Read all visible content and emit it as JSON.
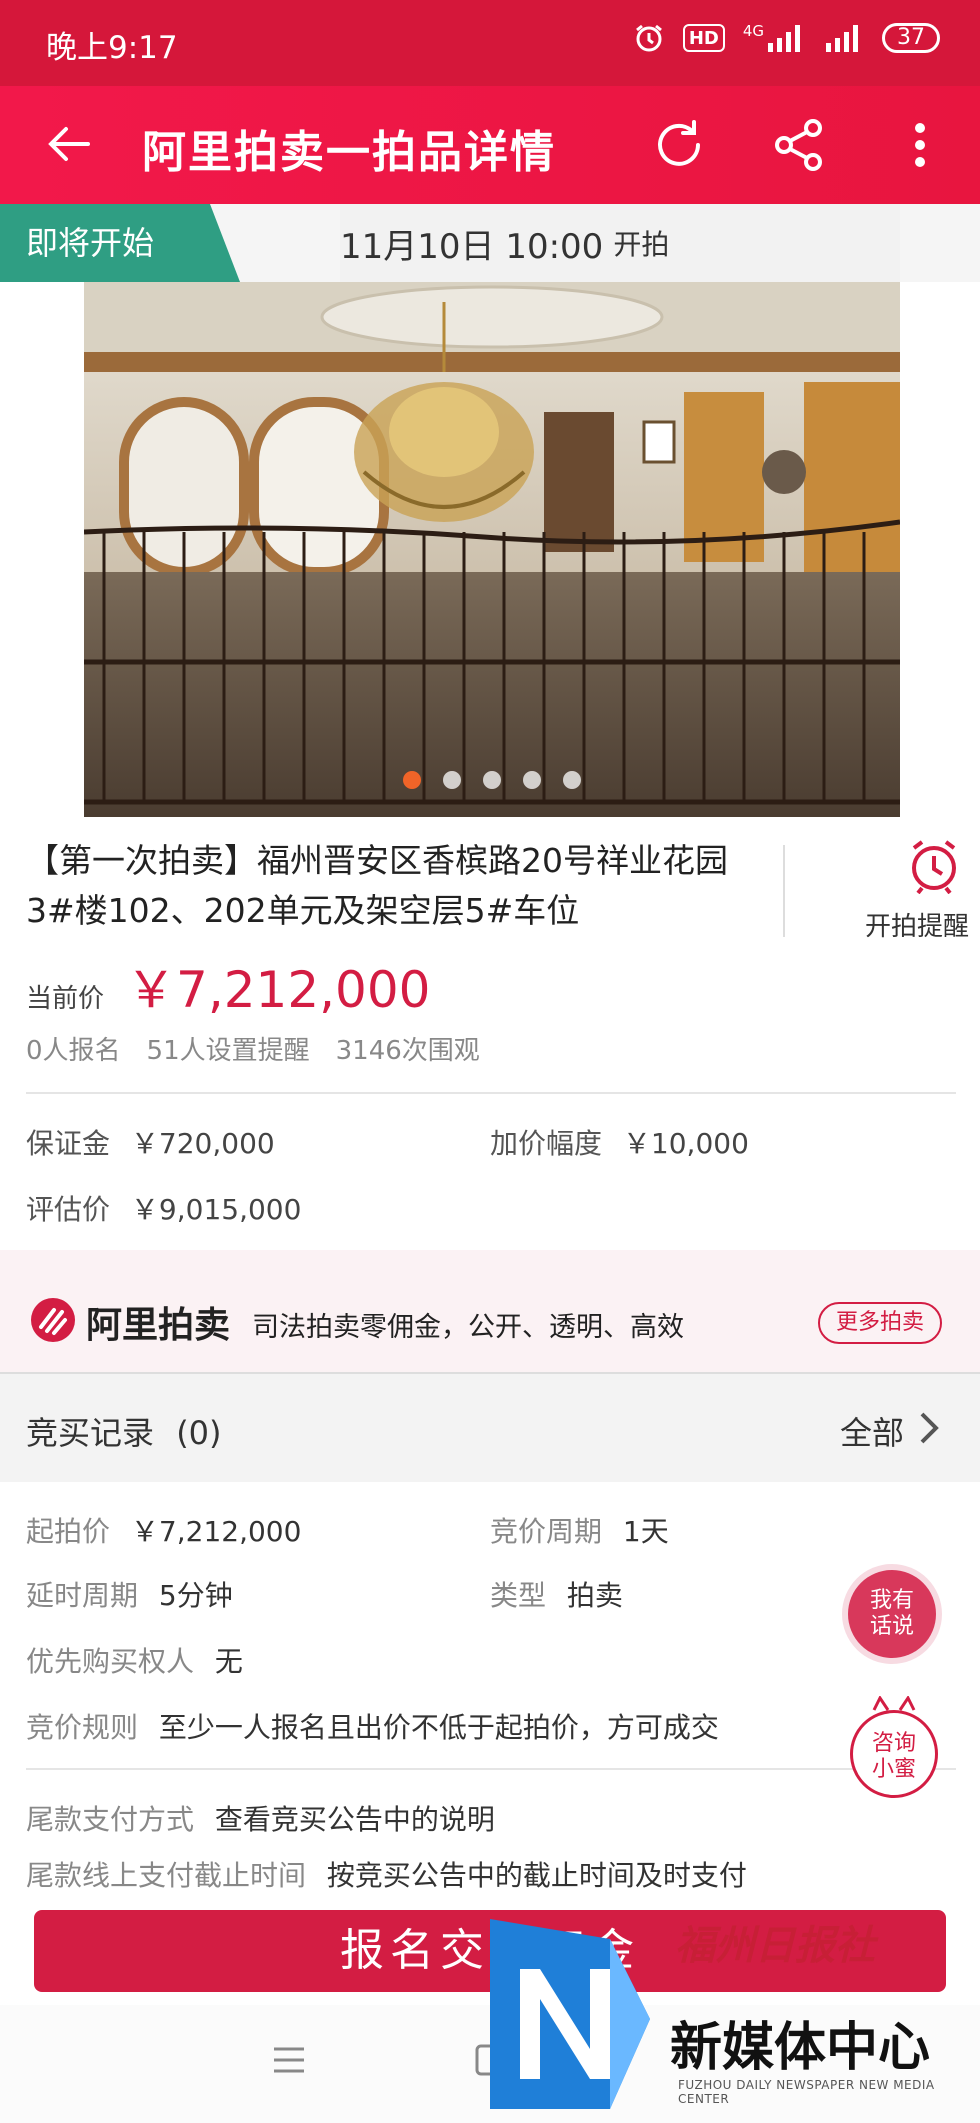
{
  "status_bar": {
    "time": "晚上9:17",
    "network": "4G",
    "hd": "HD",
    "battery": "37"
  },
  "nav": {
    "title": "阿里拍卖一拍品详情"
  },
  "banner": {
    "tag": "即将开始",
    "date": "11月10日 10:00",
    "suffix": "开拍"
  },
  "gallery": {
    "count": 5,
    "active_index": 0
  },
  "item": {
    "title": "【第一次拍卖】福州晋安区香槟路20号祥业花园3#楼102、202单元及架空层5#车位",
    "remind_label": "开拍提醒",
    "price_label": "当前价",
    "price": "￥7,212,000",
    "stats": [
      "0人报名",
      "51人设置提醒",
      "3146次围观"
    ]
  },
  "terms": {
    "deposit_label": "保证金",
    "deposit": "￥720,000",
    "increment_label": "加价幅度",
    "increment": "￥10,000",
    "appraisal_label": "评估价",
    "appraisal": "￥9,015,000"
  },
  "ali": {
    "brand": "阿里拍卖",
    "slogan": "司法拍卖零佣金，公开、透明、高效",
    "more": "更多拍卖"
  },
  "records": {
    "label": "竞买记录",
    "count": "(0)",
    "all": "全部"
  },
  "details": {
    "start_price_label": "起拍价",
    "start_price": "￥7,212,000",
    "cycle_label": "竞价周期",
    "cycle": "1天",
    "delay_label": "延时周期",
    "delay": "5分钟",
    "type_label": "类型",
    "type": "拍卖",
    "priority_label": "优先购买权人",
    "priority": "无",
    "rule_label": "竞价规则",
    "rule": "至少一人报名且出价不低于起拍价，方可成交",
    "payment_label": "尾款支付方式",
    "payment": "查看竞买公告中的说明",
    "deadline_label": "尾款线上支付截止时间",
    "deadline": "按竞买公告中的截止时间及时支付"
  },
  "floating": {
    "talk": "我有\n话说",
    "help": "咨询\n小蜜"
  },
  "bottom": {
    "cta": "报名交保证金"
  },
  "watermark": {
    "calligraphy": "福州日报社",
    "name": "新媒体中心",
    "english": "FUZHOU DAILY NEWSPAPER NEW MEDIA CENTER"
  },
  "colors": {
    "brand_red": "#d31d43",
    "nav_red": "#f2184a",
    "tag_green": "#2f9e83",
    "gallery_active": "#f06428"
  }
}
